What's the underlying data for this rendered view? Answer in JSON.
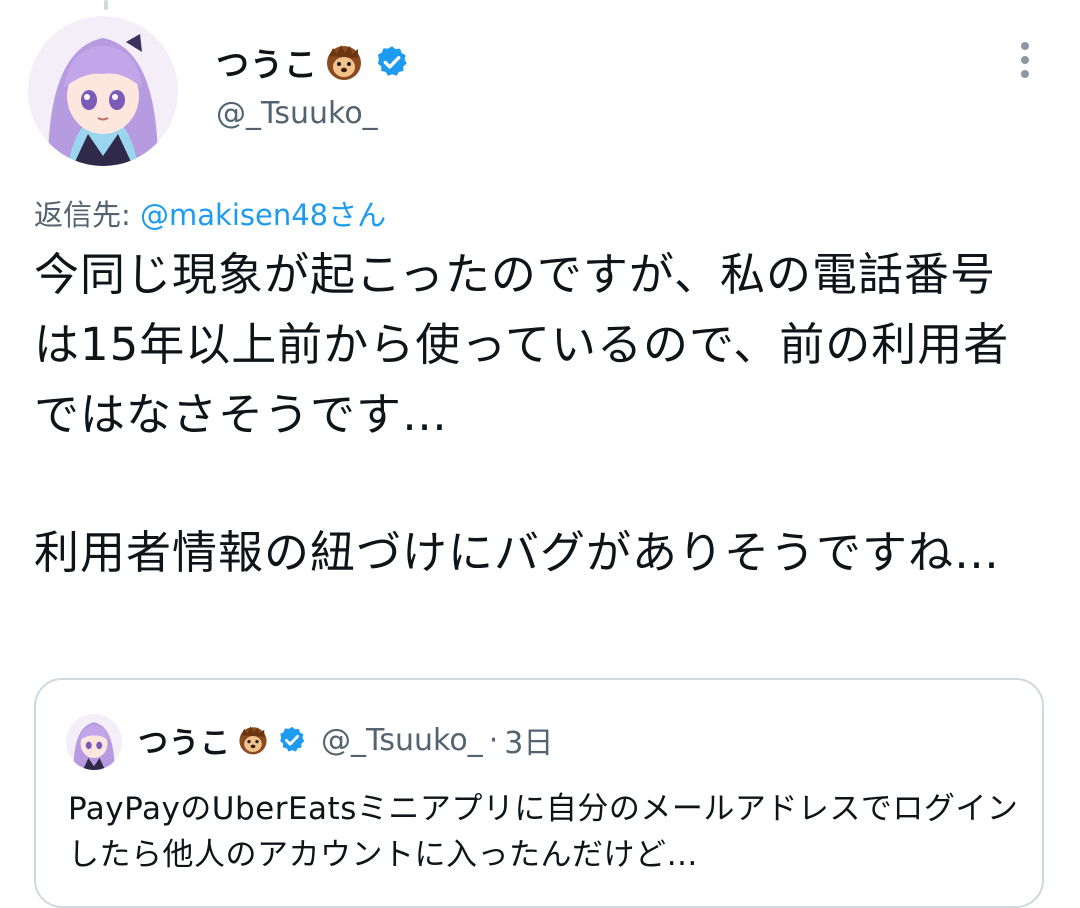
{
  "tweet": {
    "author": {
      "display_name": "つうこ",
      "emoji": "hedgehog-emoji",
      "verified": true,
      "handle": "@_Tsuuko_"
    },
    "reply_to_label": "返信先: ",
    "reply_to_mention": "@makisen48さん",
    "text_paragraphs": [
      "今同じ現象が起こったのですが、私の電話番号は15年以上前から使っているので、前の利用者ではなさそうです…",
      "利用者情報の紐づけにバグがありそうですね…"
    ]
  },
  "quoted_tweet": {
    "display_name": "つうこ",
    "emoji": "hedgehog-emoji",
    "verified": true,
    "handle": "@_Tsuuko_",
    "separator": "·",
    "time": "3日",
    "text": "PayPayのUberEatsミニアプリに自分のメールアドレスでログインしたら他人のアカウントに入ったんだけど…"
  },
  "colors": {
    "accent": "#1d9bf0",
    "secondary_text": "#536471",
    "border": "#cfd9de"
  },
  "icons": [
    "more-vertical-icon",
    "verified-badge-icon",
    "hedgehog-emoji"
  ]
}
